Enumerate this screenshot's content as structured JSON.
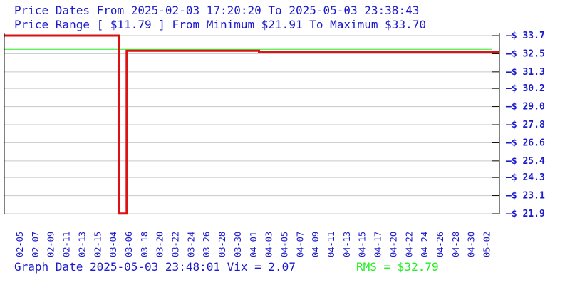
{
  "header": {
    "dates_line": "Price Dates From 2025-02-03 17:20:20 To 2025-05-03 23:38:43",
    "range_line": "Price Range [ $11.79 ] From Minimum $21.91 To Maximum $33.70"
  },
  "footer": {
    "graph_date": "Graph Date 2025-05-03 23:48:01 Vix = 2.07",
    "rms": "RMS = $32.79"
  },
  "colors": {
    "text": "#1a1acc",
    "price_line": "#dd1111",
    "rms_line": "#22ee22",
    "grid": "#c8c8c8",
    "axis": "#000000"
  },
  "chart_data": {
    "type": "line",
    "ylim": [
      21.9,
      33.7
    ],
    "y_ticks": [
      "$ 33.7",
      "$ 32.5",
      "$ 31.3",
      "$ 30.2",
      "$ 29.0",
      "$ 27.8",
      "$ 26.6",
      "$ 25.4",
      "$ 24.3",
      "$ 23.1",
      "$ 21.9"
    ],
    "y_tick_values": [
      33.7,
      32.5,
      31.3,
      30.2,
      29.0,
      27.8,
      26.6,
      25.4,
      24.3,
      23.1,
      21.9
    ],
    "x_ticks": [
      "02-05",
      "02-07",
      "02-09",
      "02-11",
      "02-13",
      "02-15",
      "03-04",
      "03-06",
      "03-18",
      "03-20",
      "03-22",
      "03-24",
      "03-26",
      "03-28",
      "03-30",
      "04-01",
      "04-03",
      "04-05",
      "04-07",
      "04-09",
      "04-11",
      "04-13",
      "04-15",
      "04-17",
      "04-20",
      "04-22",
      "04-24",
      "04-26",
      "04-28",
      "04-30",
      "05-02"
    ],
    "rms": 32.79,
    "grid": true,
    "series": [
      {
        "points": [
          {
            "x": 0.0,
            "y": 33.7
          },
          {
            "x": 6.4,
            "y": 33.7
          },
          {
            "x": 6.4,
            "y": 21.91
          },
          {
            "x": 6.9,
            "y": 21.91
          },
          {
            "x": 6.9,
            "y": 32.7
          },
          {
            "x": 15.4,
            "y": 32.7
          },
          {
            "x": 15.4,
            "y": 32.6
          },
          {
            "x": 31.6,
            "y": 32.6
          }
        ]
      }
    ]
  }
}
